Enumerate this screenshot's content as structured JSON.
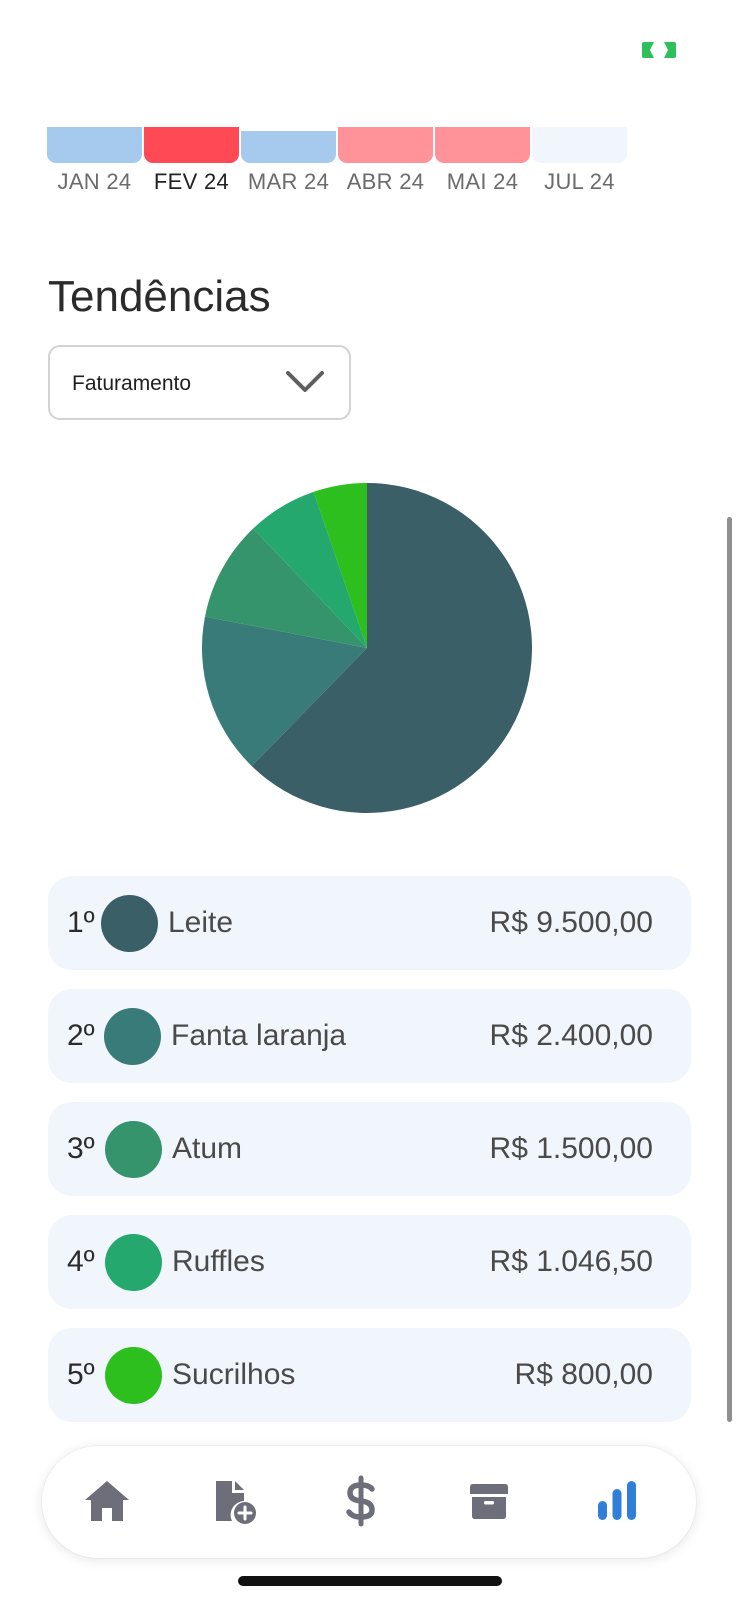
{
  "status": {
    "icon": "battery-charging-icon",
    "color": "#2ec05a"
  },
  "months": [
    {
      "label": "JAN 24",
      "level": 0.85,
      "color": "#a6c9ee"
    },
    {
      "label": "FEV 24",
      "level": 0.85,
      "color": "#ff4a55"
    },
    {
      "label": "MAR 24",
      "level": 0.75,
      "color": "#a6c9ee"
    },
    {
      "label": "ABR 24",
      "level": 0.85,
      "color": "#ff9399"
    },
    {
      "label": "MAI 24",
      "level": 0.85,
      "color": "#ff9399"
    },
    {
      "label": "JUL 24",
      "level": 0.85,
      "color": "#f1f6fc"
    }
  ],
  "active_month": "FEV 24",
  "section": {
    "title": "Tendências"
  },
  "dropdown": {
    "value": "Faturamento",
    "icon": "chevron-down-icon"
  },
  "chart_data": {
    "type": "pie",
    "categories": [
      "Leite",
      "Fanta laranja",
      "Atum",
      "Ruffles",
      "Sucrilhos"
    ],
    "values": [
      9500.0,
      2400.0,
      1500.0,
      1046.5,
      800.0
    ],
    "colors": [
      "#3a5f66",
      "#387b78",
      "#35946c",
      "#25a86d",
      "#2cbf1e"
    ]
  },
  "ranking": [
    {
      "position": "1º",
      "name": "Leite",
      "value": "R$ 9.500,00",
      "color": "#3a5f66"
    },
    {
      "position": "2º",
      "name": "Fanta laranja",
      "value": "R$ 2.400,00",
      "color": "#387b78"
    },
    {
      "position": "3º",
      "name": "Atum",
      "value": "R$ 1.500,00",
      "color": "#35946c"
    },
    {
      "position": "4º",
      "name": "Ruffles",
      "value": "R$ 1.046,50",
      "color": "#25a86d"
    },
    {
      "position": "5º",
      "name": "Sucrilhos",
      "value": "R$ 800,00",
      "color": "#2cbf1e"
    }
  ],
  "tabbar": {
    "items": [
      {
        "icon": "home-icon",
        "active": false
      },
      {
        "icon": "document-add-icon",
        "active": false
      },
      {
        "icon": "dollar-icon",
        "active": false
      },
      {
        "icon": "box-icon",
        "active": false
      },
      {
        "icon": "bar-chart-icon",
        "active": true
      }
    ],
    "active_color": "#2f7fd8",
    "inactive_color": "#6e6e7a"
  }
}
